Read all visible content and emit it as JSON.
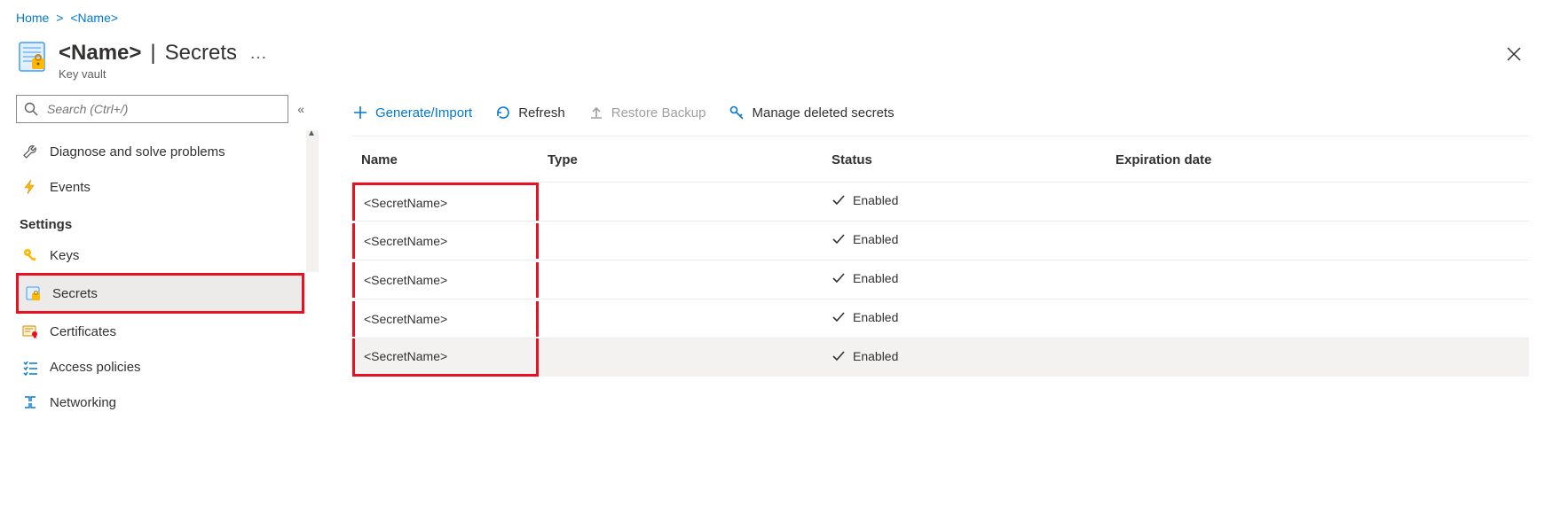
{
  "breadcrumb": {
    "home": "Home",
    "name": "<Name>"
  },
  "header": {
    "name": "<Name>",
    "page": "Secrets",
    "subtitle": "Key vault",
    "ellipsis": "…",
    "close": "✕"
  },
  "search": {
    "placeholder": "Search (Ctrl+/)"
  },
  "collapse": "«",
  "sidebar": {
    "diagnose": "Diagnose and solve problems",
    "events": "Events",
    "settings_section": "Settings",
    "keys": "Keys",
    "secrets": "Secrets",
    "certificates": "Certificates",
    "access_policies": "Access policies",
    "networking": "Networking"
  },
  "toolbar": {
    "generate": "Generate/Import",
    "refresh": "Refresh",
    "restore": "Restore Backup",
    "manage": "Manage deleted secrets"
  },
  "columns": {
    "name": "Name",
    "type": "Type",
    "status": "Status",
    "expiration": "Expiration date"
  },
  "status_enabled": "Enabled",
  "secrets": [
    {
      "name": "<SecretName>",
      "type": "",
      "status": "Enabled",
      "expiration": ""
    },
    {
      "name": "<SecretName>",
      "type": "",
      "status": "Enabled",
      "expiration": ""
    },
    {
      "name": "<SecretName>",
      "type": "",
      "status": "Enabled",
      "expiration": ""
    },
    {
      "name": "<SecretName>",
      "type": "",
      "status": "Enabled",
      "expiration": ""
    },
    {
      "name": "<SecretName>",
      "type": "",
      "status": "Enabled",
      "expiration": ""
    }
  ]
}
